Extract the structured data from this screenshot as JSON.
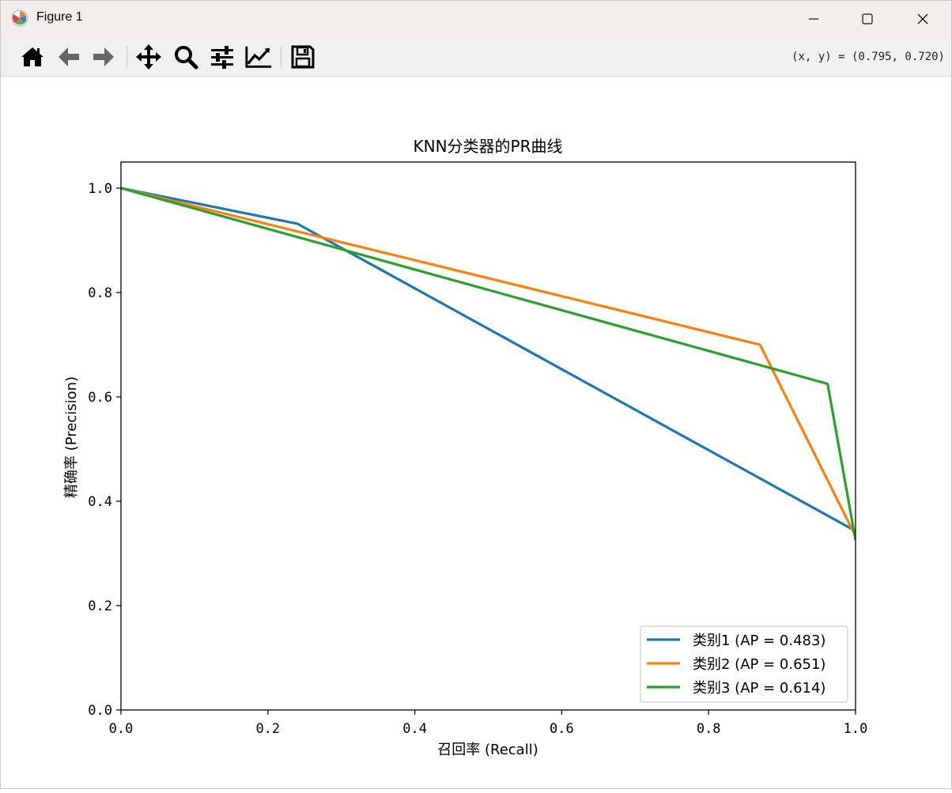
{
  "window": {
    "title": "Figure 1"
  },
  "toolbar": {
    "coord_readout": "(x, y) = (0.795, 0.720)",
    "tools": [
      "home-icon",
      "back-icon",
      "forward-icon",
      "pan-icon",
      "zoom-icon",
      "configure-subplots-icon",
      "edit-axis-icon",
      "save-icon"
    ]
  },
  "chart_data": {
    "type": "line",
    "title": "KNN分类器的PR曲线",
    "xlabel": "召回率 (Recall)",
    "ylabel": "精确率 (Precision)",
    "xlim": [
      0.0,
      1.0
    ],
    "ylim": [
      0.0,
      1.05
    ],
    "xticks": [
      0.0,
      0.2,
      0.4,
      0.6,
      0.8,
      1.0
    ],
    "xtick_labels": [
      "0.0",
      "0.2",
      "0.4",
      "0.6",
      "0.8",
      "1.0"
    ],
    "yticks": [
      0.0,
      0.2,
      0.4,
      0.6,
      0.8,
      1.0
    ],
    "ytick_labels": [
      "0.0",
      "0.2",
      "0.4",
      "0.6",
      "0.8",
      "1.0"
    ],
    "grid": false,
    "legend_position": "lower-right",
    "series": [
      {
        "name": "类别1 (AP = 0.483)",
        "color": "#1f77b4",
        "x": [
          0.0,
          0.24,
          1.0
        ],
        "y": [
          1.0,
          0.932,
          0.343
        ]
      },
      {
        "name": "类别2 (AP = 0.651)",
        "color": "#ff7f0e",
        "x": [
          0.0,
          0.87,
          1.0
        ],
        "y": [
          1.0,
          0.7,
          0.333
        ]
      },
      {
        "name": "类别3 (AP = 0.614)",
        "color": "#2ca02c",
        "x": [
          0.0,
          0.962,
          1.0
        ],
        "y": [
          1.0,
          0.625,
          0.325
        ]
      }
    ]
  }
}
